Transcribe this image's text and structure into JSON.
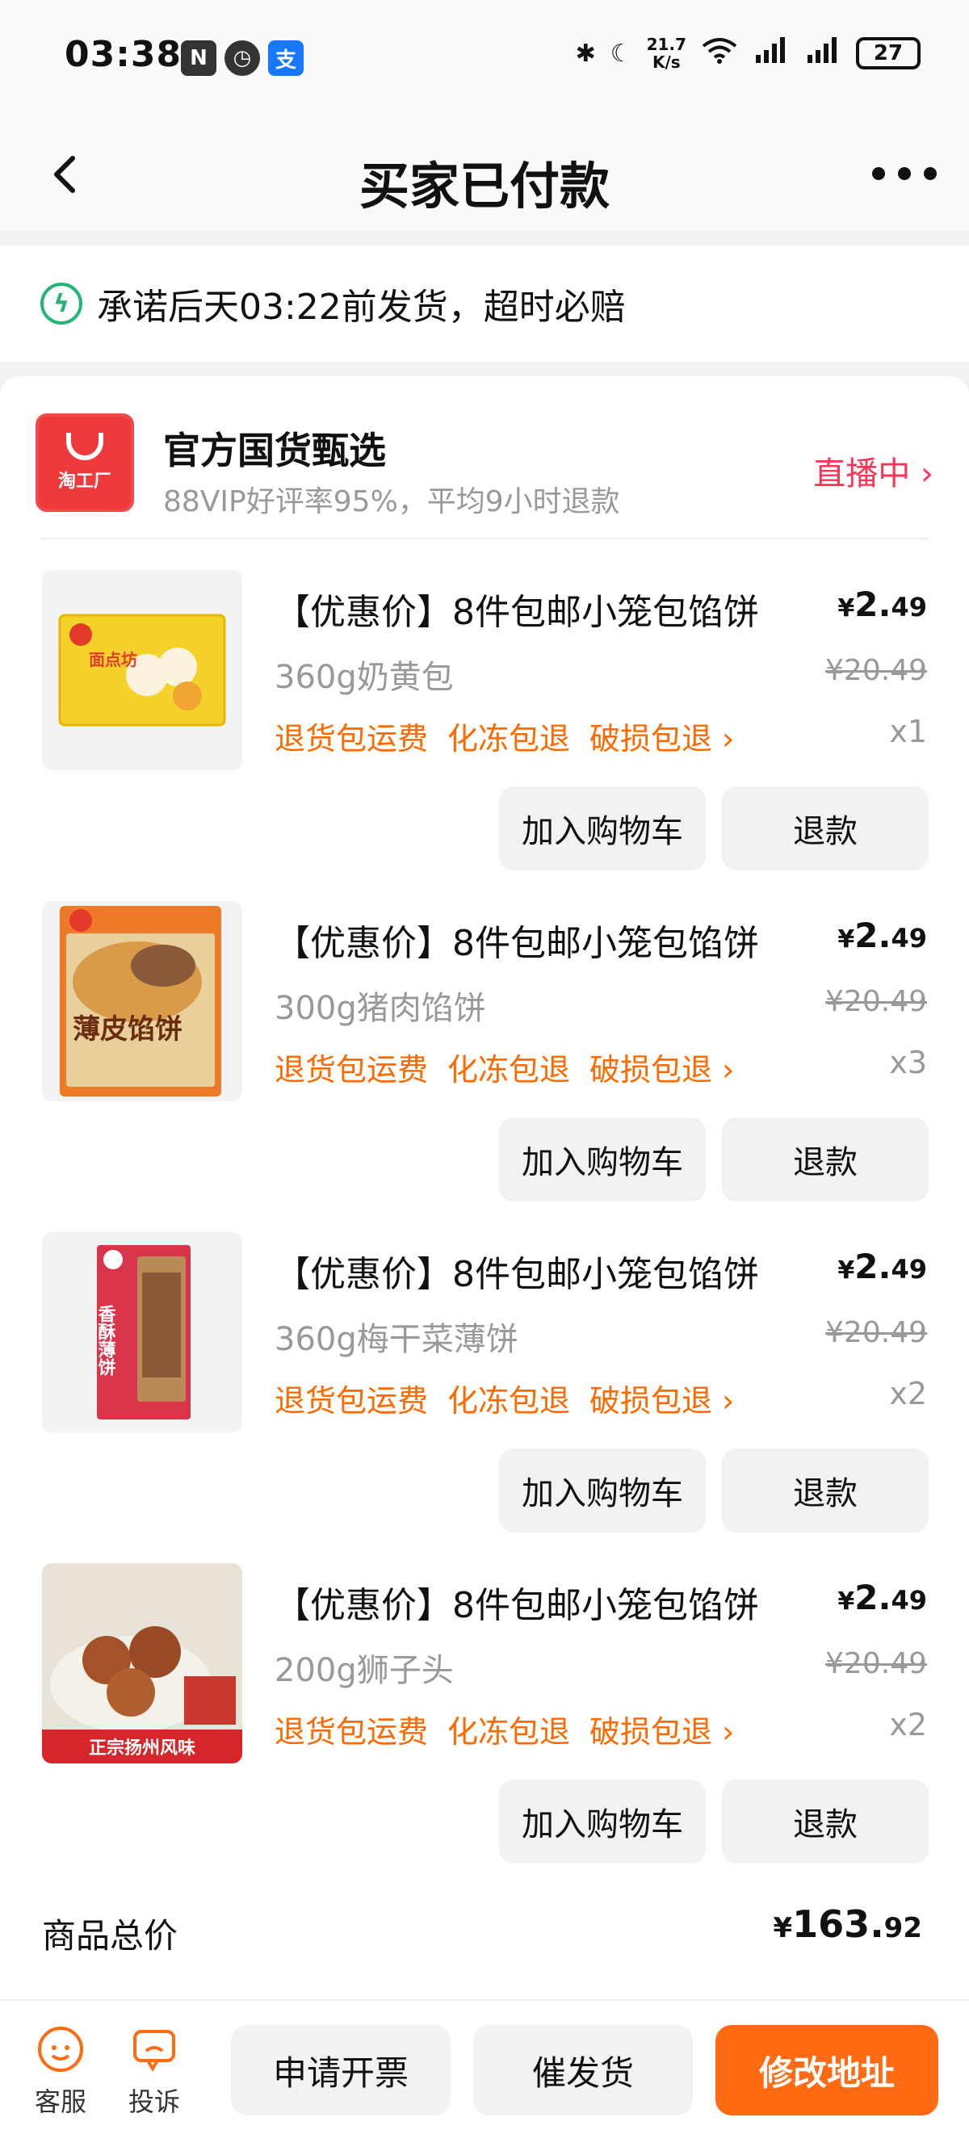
{
  "status_bar": {
    "time": "03:38",
    "net_speed_value": "21.7",
    "net_speed_unit": "K/s",
    "battery": "27"
  },
  "nav": {
    "title": "买家已付款"
  },
  "promise": {
    "text": "承诺后天03:22前发货，超时必赔"
  },
  "shop": {
    "logo_text": "淘工厂",
    "name": "官方国货甄选",
    "subtitle": "88VIP好评率95%，平均9小时退款",
    "live_label": "直播中"
  },
  "items": [
    {
      "title": "【优惠价】8件包邮小笼包馅饼",
      "price_int": "2.",
      "price_dec": "49",
      "currency": "¥",
      "spec": "360g奶黄包",
      "original_price": "¥20.49",
      "tags": [
        "退货包运费",
        "化冻包退",
        "破损包退"
      ],
      "qty": "x1",
      "image_label": "面点坊",
      "add_cart": "加入购物车",
      "refund": "退款"
    },
    {
      "title": "【优惠价】8件包邮小笼包馅饼",
      "price_int": "2.",
      "price_dec": "49",
      "currency": "¥",
      "spec": "300g猪肉馅饼",
      "original_price": "¥20.49",
      "tags": [
        "退货包运费",
        "化冻包退",
        "破损包退"
      ],
      "qty": "x3",
      "image_label": "薄皮馅饼",
      "add_cart": "加入购物车",
      "refund": "退款"
    },
    {
      "title": "【优惠价】8件包邮小笼包馅饼",
      "price_int": "2.",
      "price_dec": "49",
      "currency": "¥",
      "spec": "360g梅干菜薄饼",
      "original_price": "¥20.49",
      "tags": [
        "退货包运费",
        "化冻包退",
        "破损包退"
      ],
      "qty": "x2",
      "image_label": "香酥薄饼",
      "add_cart": "加入购物车",
      "refund": "退款"
    },
    {
      "title": "【优惠价】8件包邮小笼包馅饼",
      "price_int": "2.",
      "price_dec": "49",
      "currency": "¥",
      "spec": "200g狮子头",
      "original_price": "¥20.49",
      "tags": [
        "退货包运费",
        "化冻包退",
        "破损包退"
      ],
      "qty": "x2",
      "image_label": "正宗扬州风味",
      "add_cart": "加入购物车",
      "refund": "退款"
    }
  ],
  "total": {
    "label": "商品总价",
    "currency": "¥",
    "value_int": "163.",
    "value_dec": "92"
  },
  "bottom_bar": {
    "service_label": "客服",
    "complain_label": "投诉",
    "invoice_label": "申请开票",
    "urge_label": "催发货",
    "address_label": "修改地址"
  },
  "colors": {
    "accent_orange": "#ff6a13",
    "tag_orange": "#ff6a00",
    "live_red": "#ff3355",
    "promise_green": "#22b573"
  }
}
